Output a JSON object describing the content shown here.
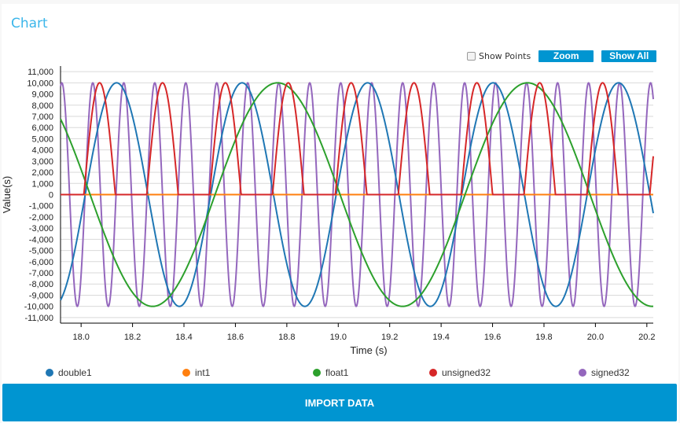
{
  "header": {
    "title": "Chart"
  },
  "controls": {
    "show_points_label": "Show Points",
    "show_points_checked": false,
    "zoom_label": "Zoom",
    "show_all_label": "Show All"
  },
  "import_button": {
    "label": "IMPORT DATA"
  },
  "colors": {
    "accent": "#0095d1",
    "title": "#3bb6ea"
  },
  "chart_data": {
    "type": "line",
    "title": "",
    "xlabel": "Time (s)",
    "ylabel": "Value(s)",
    "xlim": [
      17.92,
      20.225
    ],
    "ylim": [
      -11500,
      11500
    ],
    "grid": true,
    "legend_position": "bottom",
    "x_ticks": [
      18.0,
      18.2,
      18.4,
      18.6,
      18.8,
      19.0,
      19.2,
      19.4,
      19.6,
      19.8,
      20.0,
      20.2
    ],
    "x_tick_labels": [
      "18.0",
      "18.2",
      "18.4",
      "18.6",
      "18.8",
      "19.0",
      "19.2",
      "19.4",
      "19.6",
      "19.8",
      "20.0",
      "20.2"
    ],
    "y_ticks": [
      11000,
      10000,
      9000,
      8000,
      7000,
      6000,
      5000,
      4000,
      3000,
      2000,
      1000,
      0,
      -1000,
      -2000,
      -3000,
      -4000,
      -5000,
      -6000,
      -7000,
      -8000,
      -9000,
      -10000,
      -11000
    ],
    "y_tick_labels": [
      "11,000",
      "10,000",
      "9,000",
      "8,000",
      "7,000",
      "6,000",
      "5,000",
      "4,000",
      "3,000",
      "2,000",
      "1,000",
      "0",
      "-1,000",
      "-2,000",
      "-3,000",
      "-4,000",
      "-5,000",
      "-6,000",
      "-7,000",
      "-8,000",
      "-9,000",
      "-10,000",
      "-11,000"
    ],
    "series": [
      {
        "name": "double1",
        "color": "#1f77b4",
        "shape": "sine",
        "amplitude": 10000,
        "period_s": 0.488,
        "peak_at_s": 18.138,
        "offset": 0
      },
      {
        "name": "int1",
        "color": "#ff7f0e",
        "shape": "constant",
        "value": 0
      },
      {
        "name": "float1",
        "color": "#2ca02c",
        "shape": "sine",
        "amplitude": 10000,
        "period_s": 0.972,
        "peak_at_s": 18.764,
        "offset": 0
      },
      {
        "name": "unsigned32",
        "color": "#d62728",
        "shape": "half-rectified-sine",
        "amplitude": 10000,
        "period_s": 0.2445,
        "peak_at_s": 18.072,
        "offset": 0
      },
      {
        "name": "signed32",
        "color": "#9467bd",
        "shape": "sine",
        "amplitude": 10000,
        "period_s": 0.1205,
        "peak_at_s": 17.925,
        "offset": 0
      }
    ]
  }
}
